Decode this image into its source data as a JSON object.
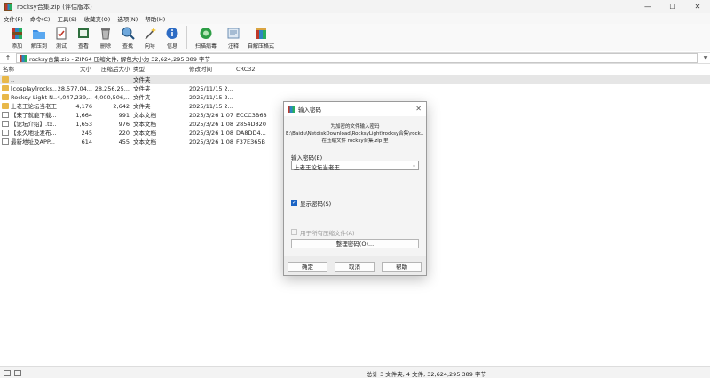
{
  "window": {
    "title": "rocksy合集.zip (评估版本)"
  },
  "window_controls": [
    "—",
    "☐",
    "✕"
  ],
  "menu": [
    "文件(F)",
    "命令(C)",
    "工具(S)",
    "收藏夹(O)",
    "选项(N)",
    "帮助(H)"
  ],
  "toolbar": [
    {
      "label": "添加",
      "icon": "add-archive-icon"
    },
    {
      "label": "解压到",
      "icon": "extract-folder-icon"
    },
    {
      "label": "测试",
      "icon": "test-icon"
    },
    {
      "label": "查看",
      "icon": "view-icon"
    },
    {
      "label": "删除",
      "icon": "delete-icon"
    },
    {
      "label": "查找",
      "icon": "find-icon"
    },
    {
      "label": "向导",
      "icon": "wizard-icon"
    },
    {
      "label": "信息",
      "icon": "info-icon"
    },
    {
      "label": "扫描病毒",
      "icon": "virus-scan-icon"
    },
    {
      "label": "注释",
      "icon": "comment-icon"
    },
    {
      "label": "自解压格式",
      "icon": "sfx-icon"
    }
  ],
  "address": {
    "text": "rocksy合集.zip - ZIP64 压缩文件, 解包大小为 32,624,295,389 字节"
  },
  "columns": [
    "名称",
    "大小",
    "压缩后大小",
    "类型",
    "修改时间",
    "CRC32"
  ],
  "rows": [
    {
      "name": "..",
      "size": "",
      "packed": "",
      "type": "文件夹",
      "modified": "",
      "crc": "",
      "icon": "updir"
    },
    {
      "name": "[cosplay]rocks...",
      "size": "28,577,04...",
      "packed": "28,256,25...",
      "type": "文件夹",
      "modified": "2025/11/15 2...",
      "crc": "",
      "icon": "folder"
    },
    {
      "name": "Rocksy Light N...",
      "size": "4,047,239,...",
      "packed": "4,000,506,...",
      "type": "文件夹",
      "modified": "2025/11/15 2...",
      "crc": "",
      "icon": "folder"
    },
    {
      "name": "上老王论坛当老王",
      "size": "4,176",
      "packed": "2,642",
      "type": "文件夹",
      "modified": "2025/11/15 2...",
      "crc": "",
      "icon": "folder"
    },
    {
      "name": "【来了就能下载...",
      "size": "1,664",
      "packed": "991",
      "type": "文本文档",
      "modified": "2025/3/26 1:07",
      "crc": "ECCC3B68",
      "icon": "txt"
    },
    {
      "name": "【论坛介绍】.tx...",
      "size": "1,653",
      "packed": "976",
      "type": "文本文档",
      "modified": "2025/3/26 1:08",
      "crc": "2854D820",
      "icon": "txt"
    },
    {
      "name": "【永久地址发布...",
      "size": "245",
      "packed": "220",
      "type": "文本文档",
      "modified": "2025/3/26 1:08",
      "crc": "DA8DD4...",
      "icon": "txt"
    },
    {
      "name": "最新地址及APP...",
      "size": "614",
      "packed": "455",
      "type": "文本文档",
      "modified": "2025/3/26 1:08",
      "crc": "F37E365B",
      "icon": "txt"
    }
  ],
  "status": {
    "text": "总计 3 文件夹, 4 文件, 32,624,295,389 字节"
  },
  "dialog": {
    "title": "输入密码",
    "line1": "为加密的文件输入密码",
    "line2": "E:\\Baidu\\NetdiskDownload\\RocksyLight\\rocksy合集\\rock...\\001.jpg",
    "line3": "在压缩文件 rocksy合集.zip 里",
    "password_label": "输入密码(E)",
    "password_value": "上老王论坛当老王",
    "show_password": "显示密码(S)",
    "use_all": "用于所有压缩文件(A)",
    "organize": "整理密码(O)...",
    "ok": "确定",
    "cancel": "取消",
    "help": "帮助"
  }
}
